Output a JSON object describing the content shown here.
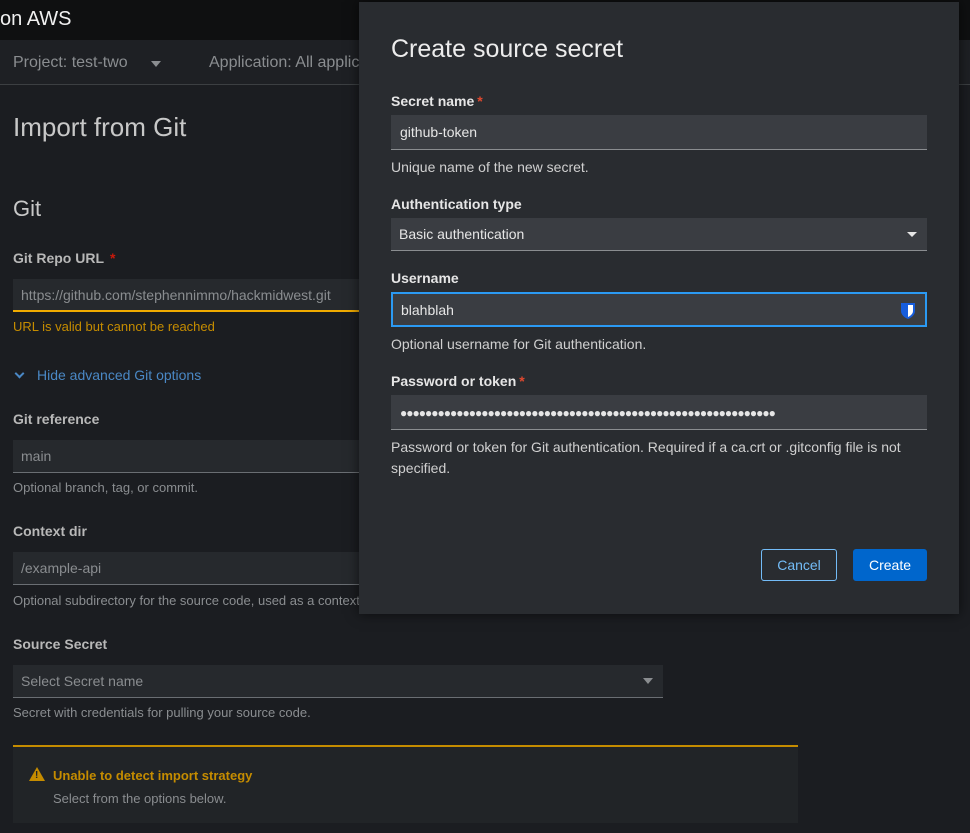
{
  "topbar": {
    "title": "on AWS"
  },
  "projectbar": {
    "project": "Project: test-two",
    "application": "Application: All applic"
  },
  "page": {
    "heading": "Import from Git",
    "section": "Git",
    "git_repo_url": {
      "label": "Git Repo URL",
      "required": "*",
      "value": "https://github.com/stephennimmo/hackmidwest.git",
      "helper": "URL is valid but cannot be reached"
    },
    "advanced_link": "Hide advanced Git options",
    "git_reference": {
      "label": "Git reference",
      "placeholder": "main",
      "helper": "Optional branch, tag, or commit."
    },
    "context_dir": {
      "label": "Context dir",
      "placeholder": "/example-api",
      "helper": "Optional subdirectory for the source code, used as a context"
    },
    "source_secret": {
      "label": "Source Secret",
      "placeholder": "Select Secret name",
      "helper": "Secret with credentials for pulling your source code."
    },
    "alert": {
      "title": "Unable to detect import strategy",
      "body": "Select from the options below."
    }
  },
  "modal": {
    "title": "Create source secret",
    "secret_name": {
      "label": "Secret name",
      "required": "*",
      "value": "github-token",
      "helper": "Unique name of the new secret."
    },
    "auth_type": {
      "label": "Authentication type",
      "value": "Basic authentication"
    },
    "username": {
      "label": "Username",
      "value": "blahblah",
      "helper": "Optional username for Git authentication."
    },
    "password": {
      "label": "Password or token",
      "required": "*",
      "value": "●●●●●●●●●●●●●●●●●●●●●●●●●●●●●●●●●●●●●●●●●●●●●●●●●●●●●●●●●●●●",
      "helper": "Password or token for Git authentication. Required if a ca.crt or .gitconfig file is not specified."
    },
    "cancel_label": "Cancel",
    "create_label": "Create"
  },
  "colors": {
    "primary_button": "#0066cc",
    "focus_border": "#2b9af3",
    "warning": "#c58c00",
    "required": "#e0492f"
  }
}
